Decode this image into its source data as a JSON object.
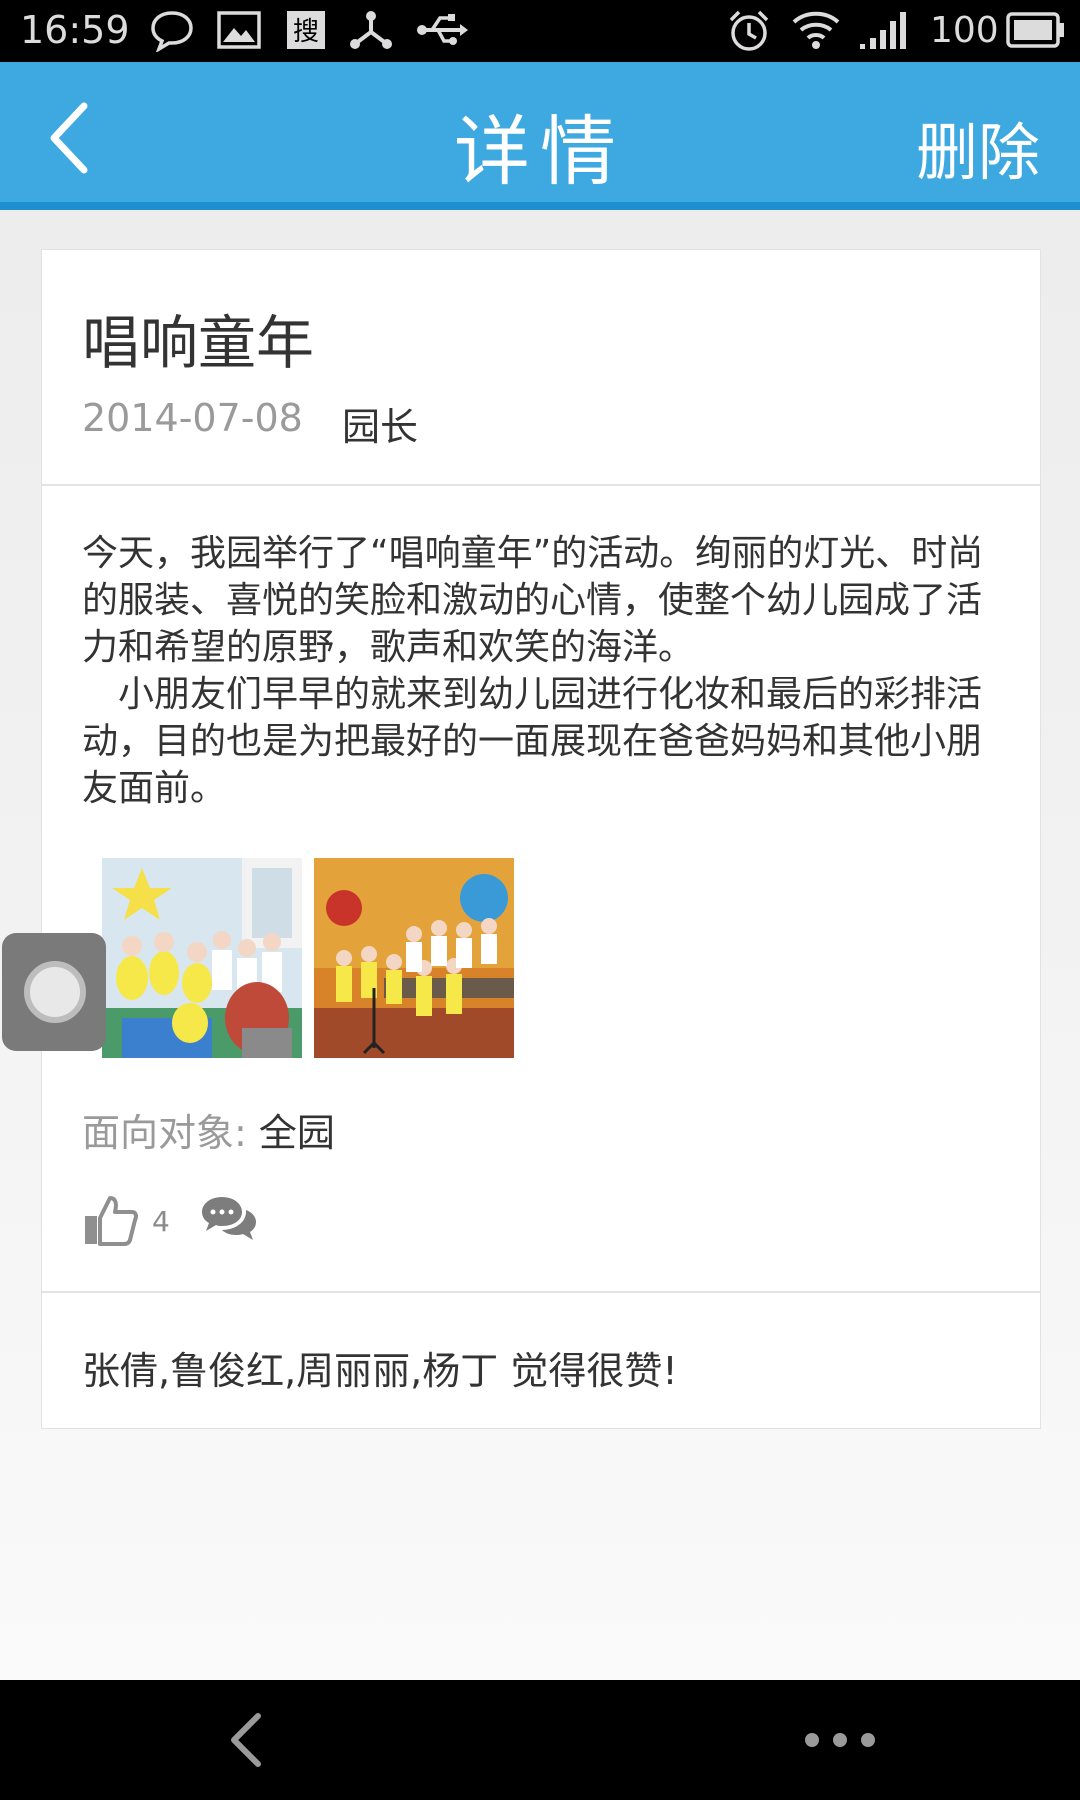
{
  "status_bar": {
    "time": "16:59",
    "battery": "100",
    "icons": [
      "chat-bubble-icon",
      "image-icon",
      "search-app-icon",
      "network-share-icon",
      "usb-icon",
      "alarm-icon",
      "wifi-icon",
      "signal-icon",
      "battery-icon"
    ]
  },
  "header": {
    "title": "详情",
    "delete_label": "删除",
    "accent_color": "#3ea8e0"
  },
  "post": {
    "title": "唱响童年",
    "date": "2014-07-08",
    "author": "园长",
    "paragraphs": [
      "今天，我园举行了“唱响童年”的活动。绚丽的灯光、时尚的服装、喜悦的笑脸和激动的心情，使整个幼儿园成了活力和希望的原野，歌声和欢笑的海洋。",
      "小朋友们早早的就来到幼儿园进行化妆和最后的彩排活动，目的也是为把最好的一面展现在爸爸妈妈和其他小朋友面前。"
    ],
    "audience_label": "面向对象: ",
    "audience_value": "全园",
    "like_count": "4",
    "likers": "张倩,鲁俊红,周丽丽,杨丁 觉得很赞!"
  }
}
